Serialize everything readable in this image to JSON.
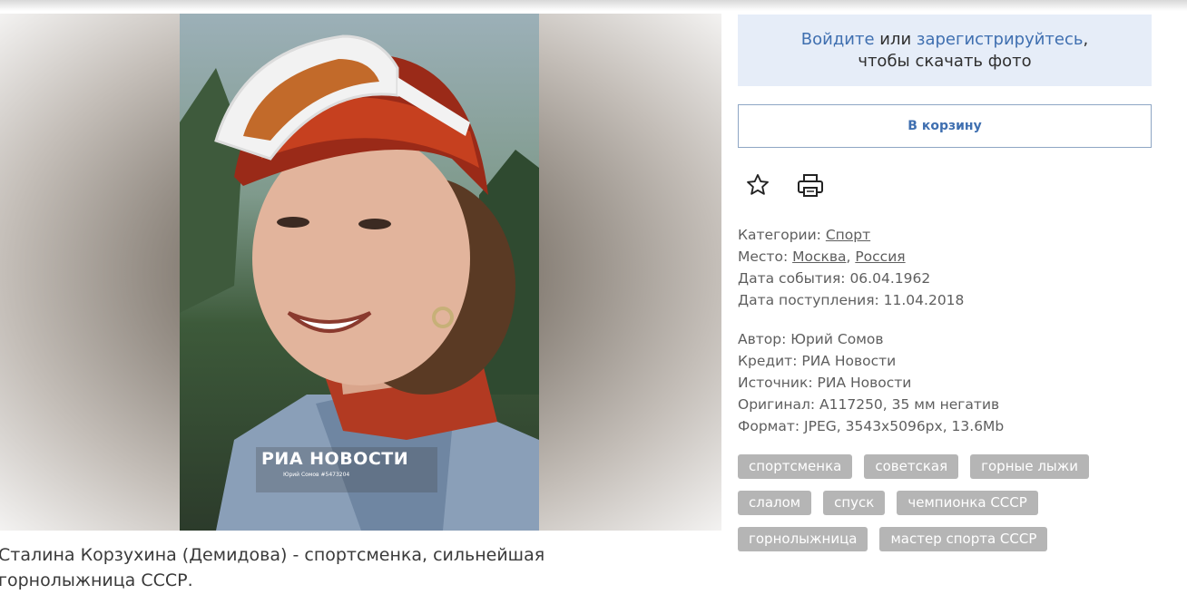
{
  "photo": {
    "watermark_logo": "РИА НОВОСТИ",
    "watermark_credit": "Юрий Сомов #5473204"
  },
  "caption": {
    "line1": "Сталина Корзухина (Демидова) - спортсменка, сильнейшая",
    "line2": "горнолыжница СССР."
  },
  "login": {
    "login_link": "Войдите",
    "or_text": " или ",
    "register_link": "зарегистрируйтесь",
    "comma": ",",
    "line2": "чтобы скачать фото"
  },
  "cart_button": "В корзину",
  "icons": {
    "favorite": "star-icon",
    "print": "printer-icon"
  },
  "meta": {
    "categories_label": "Категории: ",
    "categories_value": "Спорт",
    "place_label": "Место: ",
    "place_city": "Москва",
    "place_sep": ", ",
    "place_country": "Россия",
    "event_date": "Дата события: 06.04.1962",
    "received_date": "Дата поступления: 11.04.2018",
    "author": "Автор: Юрий Сомов",
    "credit": "Кредит: РИА Новости",
    "source": "Источник: РИА Новости",
    "original": "Оригинал: A117250, 35 мм негатив",
    "format": "Формат: JPEG, 3543x5096px, 13.6Mb"
  },
  "tags": {
    "row1": [
      "спортсменка",
      "советская",
      "горные лыжи"
    ],
    "row2": [
      "слалом",
      "спуск",
      "чемпионка СССР"
    ],
    "row3": [
      "горнолыжница",
      "мастер спорта СССР"
    ]
  },
  "colors": {
    "link": "#3f6fb0",
    "login_bg": "#e6edf8",
    "tag_bg": "#b5b5b5"
  }
}
